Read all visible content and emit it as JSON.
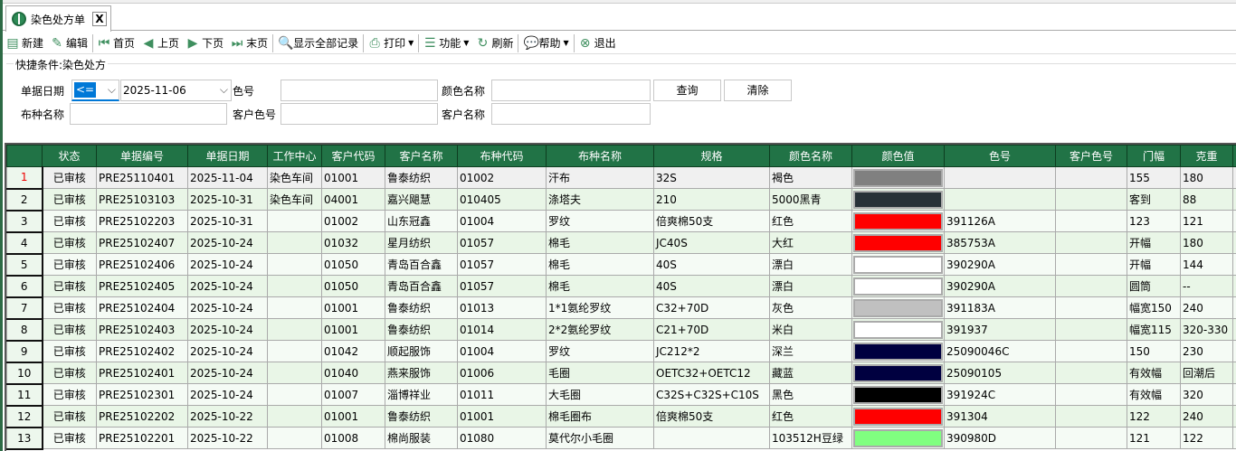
{
  "tab": {
    "title": "染色处方单",
    "close": "X"
  },
  "toolbar": [
    {
      "label": "新建",
      "icon": "document-icon",
      "glyph": "▤"
    },
    {
      "label": "编辑",
      "icon": "edit-icon",
      "glyph": "✎"
    },
    {
      "sep": true
    },
    {
      "label": "首页",
      "icon": "first-page-icon",
      "glyph": "⏮"
    },
    {
      "label": "上页",
      "icon": "previous-page-icon",
      "glyph": "◀"
    },
    {
      "label": "下页",
      "icon": "next-page-icon",
      "glyph": "▶"
    },
    {
      "label": "末页",
      "icon": "last-page-icon",
      "glyph": "⏭"
    },
    {
      "sep": true
    },
    {
      "label": "显示全部记录",
      "icon": "search-document-icon",
      "glyph": "🔍"
    },
    {
      "sep": true
    },
    {
      "label": "打印",
      "icon": "printer-icon",
      "glyph": "⎙",
      "dropdown": true
    },
    {
      "sep": true
    },
    {
      "label": "功能",
      "icon": "list-icon",
      "glyph": "☰",
      "dropdown": true
    },
    {
      "label": "刷新",
      "icon": "refresh-icon",
      "glyph": "↻"
    },
    {
      "sep": true
    },
    {
      "label": "帮助",
      "icon": "help-icon",
      "glyph": "💬",
      "dropdown": true
    },
    {
      "sep": true
    },
    {
      "label": "退出",
      "icon": "exit-icon",
      "glyph": "⊗"
    }
  ],
  "filter": {
    "legend": "快捷条件:染色处方",
    "date_label": "单据日期",
    "date_operator": "<=",
    "date_value": "2025-11-06",
    "color_no_label": "色号",
    "color_no_value": "",
    "color_name_label": "颜色名称",
    "color_name_value": "",
    "fabric_name_label": "布种名称",
    "fabric_name_value": "",
    "cust_color_no_label": "客户色号",
    "cust_color_no_value": "",
    "cust_name_label": "客户名称",
    "cust_name_value": "",
    "query_button": "查询",
    "clear_button": "清除"
  },
  "grid": {
    "columns": [
      "",
      "状态",
      "单据编号",
      "单据日期",
      "工作中心",
      "客户代码",
      "客户名称",
      "布种代码",
      "布种名称",
      "规格",
      "颜色名称",
      "颜色值",
      "色号",
      "客户色号",
      "门幅",
      "克重"
    ],
    "rows": [
      [
        "1",
        "已审核",
        "PRE25110401",
        "2025-11-04",
        "染色车间",
        "01001",
        "鲁泰纺织",
        "01002",
        "汗布",
        "32S",
        "褐色",
        "#808080",
        "",
        "",
        "155",
        "180"
      ],
      [
        "2",
        "已审核",
        "PRE25103103",
        "2025-10-31",
        "染色车间",
        "04001",
        "嘉兴飓慧",
        "010405",
        "涤塔夫",
        "210",
        "5000黑青",
        "#283238",
        "",
        "",
        "客到",
        "88"
      ],
      [
        "3",
        "已审核",
        "PRE25102203",
        "2025-10-31",
        "",
        "01002",
        "山东冠鑫",
        "01004",
        "罗纹",
        "倍爽棉50支",
        "红色",
        "#ff0000",
        "391126A",
        "",
        "123",
        "121"
      ],
      [
        "4",
        "已审核",
        "PRE25102407",
        "2025-10-24",
        "",
        "01032",
        "星月纺织",
        "01057",
        "棉毛",
        "JC40S",
        "大红",
        "#ff0000",
        "385753A",
        "",
        "开幅",
        "180"
      ],
      [
        "5",
        "已审核",
        "PRE25102406",
        "2025-10-24",
        "",
        "01050",
        "青岛百合鑫",
        "01057",
        "棉毛",
        "40S",
        "漂白",
        "#ffffff",
        "390290A",
        "",
        "开幅",
        "144"
      ],
      [
        "6",
        "已审核",
        "PRE25102405",
        "2025-10-24",
        "",
        "01050",
        "青岛百合鑫",
        "01057",
        "棉毛",
        "40S",
        "漂白",
        "#ffffff",
        "390290A",
        "",
        "圆筒",
        "--"
      ],
      [
        "7",
        "已审核",
        "PRE25102404",
        "2025-10-24",
        "",
        "01001",
        "鲁泰纺织",
        "01013",
        "1*1氨纶罗纹",
        "C32+70D",
        "灰色",
        "#c0c0c0",
        "391183A",
        "",
        "幅宽150",
        "240"
      ],
      [
        "8",
        "已审核",
        "PRE25102403",
        "2025-10-24",
        "",
        "01001",
        "鲁泰纺织",
        "01014",
        "2*2氨纶罗纹",
        "C21+70D",
        "米白",
        "#ffffff",
        "391937",
        "",
        "幅宽115",
        "320-330"
      ],
      [
        "9",
        "已审核",
        "PRE25102402",
        "2025-10-24",
        "",
        "01042",
        "顺起服饰",
        "01004",
        "罗纹",
        "JC212*2",
        "深兰",
        "#000040",
        "25090046C",
        "",
        "150",
        "230"
      ],
      [
        "10",
        "已审核",
        "PRE25102401",
        "2025-10-24",
        "",
        "01040",
        "燕来服饰",
        "01006",
        "毛圈",
        "OETC32+OETC12",
        "藏蓝",
        "#000040",
        "25090105",
        "",
        "有效幅",
        "回潮后"
      ],
      [
        "11",
        "已审核",
        "PRE25102301",
        "2025-10-24",
        "",
        "01007",
        "淄博祥业",
        "01011",
        "大毛圈",
        "C32S+C32S+C10S",
        "黑色",
        "#000000",
        "391924C",
        "",
        "有效幅",
        "320"
      ],
      [
        "12",
        "已审核",
        "PRE25102202",
        "2025-10-22",
        "",
        "01001",
        "鲁泰纺织",
        "01001",
        "棉毛圈布",
        "倍爽棉50支",
        "红色",
        "#ff0000",
        "391304",
        "",
        "122",
        "240"
      ],
      [
        "13",
        "已审核",
        "PRE25102201",
        "2025-10-22",
        "",
        "01008",
        "棉尚服装",
        "01080",
        "莫代尔小毛圈",
        "",
        " 103512H豆绿",
        "#80ff80",
        "390980D",
        "",
        "121",
        "122"
      ]
    ]
  },
  "colors": {
    "header_green": "#217346",
    "icon_green": "#3f8f5f",
    "selected_row_num": "#ee0000"
  }
}
